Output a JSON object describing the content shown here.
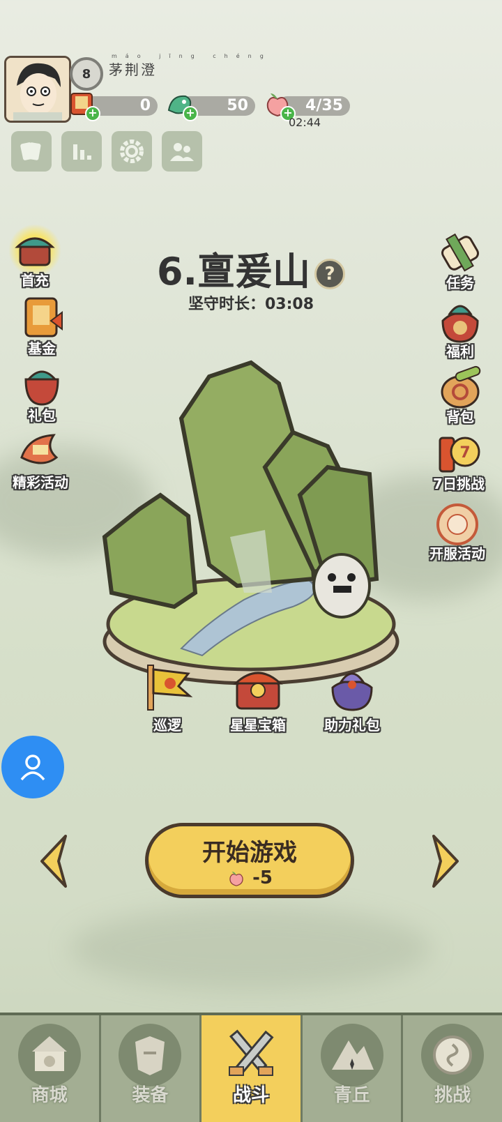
{
  "player": {
    "level": "8",
    "name": "茅荆澄",
    "name_pinyin": "máo jīng chéng"
  },
  "resources": {
    "scroll": "0",
    "jade": "50",
    "stamina": "4/35",
    "stamina_timer": "02:44"
  },
  "stage": {
    "title": "6.亶爰山",
    "help": "?",
    "guard_label": "坚守时长：03:08"
  },
  "left_menu": [
    {
      "label": "首充",
      "icon": "first-recharge-chest-icon"
    },
    {
      "label": "基金",
      "icon": "fund-icon"
    },
    {
      "label": "礼包",
      "icon": "gift-pack-icon"
    },
    {
      "label": "精彩活动",
      "icon": "events-icon"
    }
  ],
  "right_menu": [
    {
      "label": "任务",
      "icon": "quest-scroll-icon"
    },
    {
      "label": "福利",
      "icon": "welfare-bag-icon"
    },
    {
      "label": "背包",
      "icon": "backpack-icon"
    },
    {
      "label": "7日挑战",
      "icon": "seven-day-challenge-icon"
    },
    {
      "label": "开服活动",
      "icon": "server-launch-icon"
    }
  ],
  "island_buttons": [
    {
      "label": "巡逻",
      "icon": "patrol-flag-icon"
    },
    {
      "label": "星星宝箱",
      "icon": "star-chest-icon"
    },
    {
      "label": "助力礼包",
      "icon": "boost-gift-bag-icon"
    }
  ],
  "start": {
    "label": "开始游戏",
    "cost": "-5"
  },
  "nav": [
    {
      "label": "商城",
      "icon": "shop-icon",
      "active": false
    },
    {
      "label": "装备",
      "icon": "equipment-icon",
      "active": false
    },
    {
      "label": "战斗",
      "icon": "battle-swords-icon",
      "active": true
    },
    {
      "label": "青丘",
      "icon": "qingqiu-icon",
      "active": false
    },
    {
      "label": "挑战",
      "icon": "challenge-icon",
      "active": false
    }
  ],
  "colors": {
    "accent": "#f3cf5c",
    "support_button": "#2e8ef3"
  }
}
